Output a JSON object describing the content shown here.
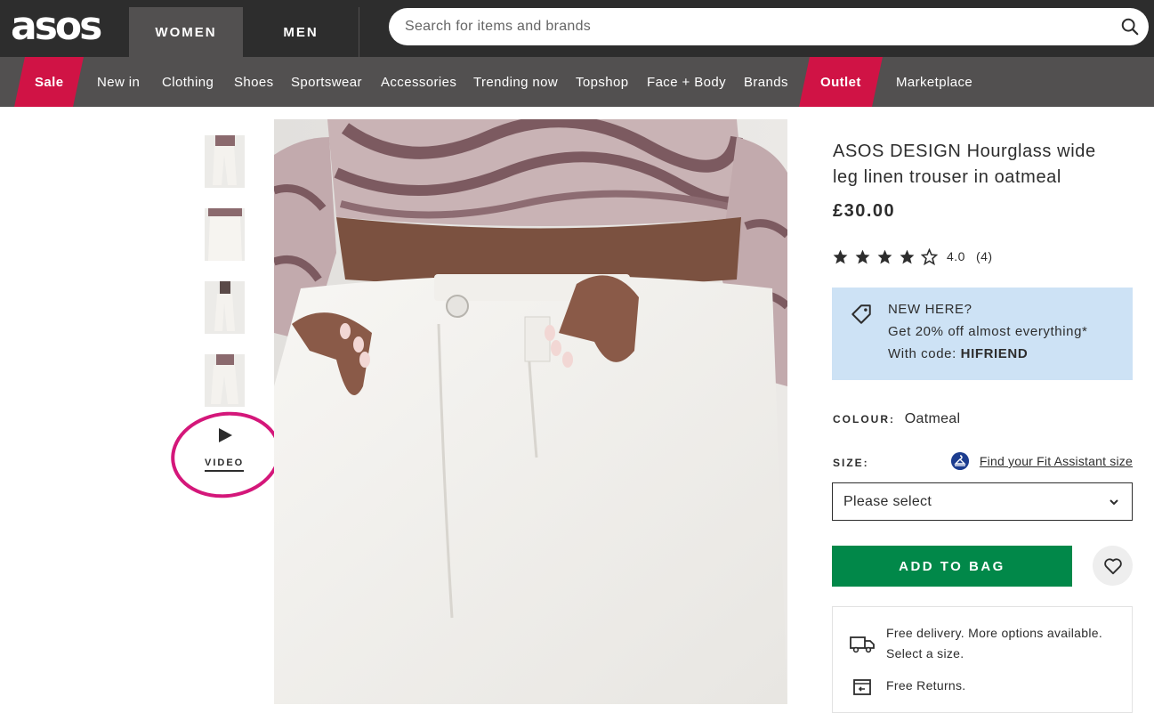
{
  "header": {
    "logo_text": "asos",
    "tabs": [
      {
        "label": "WOMEN",
        "active": true
      },
      {
        "label": "MEN",
        "active": false
      }
    ],
    "search_placeholder": "Search for items and brands"
  },
  "nav": {
    "items": [
      {
        "label": "Sale",
        "highlight": true
      },
      {
        "label": "New in"
      },
      {
        "label": "Clothing"
      },
      {
        "label": "Shoes"
      },
      {
        "label": "Sportswear"
      },
      {
        "label": "Accessories"
      },
      {
        "label": "Trending now"
      },
      {
        "label": "Topshop"
      },
      {
        "label": "Face + Body"
      },
      {
        "label": "Brands"
      },
      {
        "label": "Outlet",
        "highlight": true
      },
      {
        "label": "Marketplace"
      }
    ],
    "highlight_color": "#d01345"
  },
  "gallery": {
    "thumbnail_count": 4,
    "video_label": "VIDEO"
  },
  "product": {
    "title": "ASOS DESIGN Hourglass wide leg linen trouser in oatmeal",
    "price": "£30.00",
    "rating": {
      "stars": 4,
      "max": 5,
      "value": "4.0",
      "count": "(4)"
    },
    "promo": {
      "line1": "NEW HERE?",
      "line2": "Get 20% off almost everything*",
      "line3_prefix": "With code: ",
      "code": "HIFRIEND",
      "background": "#cde2f5"
    },
    "colour": {
      "label": "COLOUR:",
      "value": "Oatmeal"
    },
    "size": {
      "label": "SIZE:",
      "fit_link": "Find your Fit Assistant size",
      "selected": "Please select"
    },
    "add_to_bag": "ADD TO BAG",
    "add_to_bag_color": "#018849",
    "delivery": {
      "line1": "Free delivery. More options available. Select a size.",
      "line2": "Free Returns."
    }
  }
}
